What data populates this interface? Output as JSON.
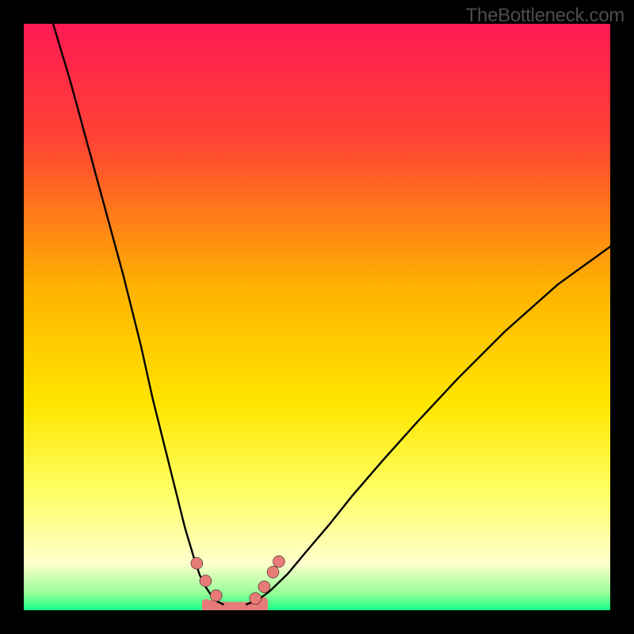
{
  "watermark": "TheBottleneck.com",
  "chart_data": {
    "type": "line",
    "title": "",
    "xlabel": "",
    "ylabel": "",
    "xlim": [
      0,
      100
    ],
    "ylim": [
      0,
      100
    ],
    "gradient_stops": [
      {
        "offset": 0,
        "color": "#ff1a53"
      },
      {
        "offset": 20,
        "color": "#ff4433"
      },
      {
        "offset": 45,
        "color": "#ffb200"
      },
      {
        "offset": 65,
        "color": "#ffe600"
      },
      {
        "offset": 80,
        "color": "#ffff66"
      },
      {
        "offset": 92,
        "color": "#ffffcc"
      },
      {
        "offset": 97,
        "color": "#99ff99"
      },
      {
        "offset": 100,
        "color": "#1aff88"
      }
    ],
    "series": [
      {
        "name": "left-curve",
        "x": [
          5,
          8,
          11,
          14,
          17,
          20,
          22,
          24,
          26,
          27.5,
          29,
          30,
          31,
          32,
          33,
          34
        ],
        "y": [
          100,
          90,
          79,
          68,
          57,
          45,
          36,
          28,
          20,
          14,
          9,
          6,
          4,
          2.5,
          1.5,
          1
        ]
      },
      {
        "name": "right-curve",
        "x": [
          38,
          40,
          42,
          45,
          48,
          52,
          56,
          61,
          67,
          74,
          82,
          91,
          100
        ],
        "y": [
          1,
          1.8,
          3.3,
          6.2,
          9.8,
          14.5,
          19.5,
          25.3,
          32,
          39.5,
          47.5,
          55.5,
          62
        ]
      },
      {
        "name": "valley-floor",
        "x": [
          31,
          33,
          35,
          36.5,
          38,
          39.5,
          41
        ],
        "y": [
          1.3,
          0.9,
          0.8,
          0.8,
          0.8,
          1.1,
          1.6
        ]
      }
    ],
    "markers": [
      {
        "name": "left-dots",
        "x": [
          29.5,
          31,
          32.8
        ],
        "y": [
          8,
          5,
          2.5
        ]
      },
      {
        "name": "right-dots",
        "x": [
          39.5,
          41,
          42.5,
          43.5
        ],
        "y": [
          2,
          4,
          6.5,
          8.3
        ]
      }
    ],
    "valley_fill": {
      "points": [
        [
          31,
          1.3
        ],
        [
          33,
          0.9
        ],
        [
          35,
          0.8
        ],
        [
          36.5,
          0.8
        ],
        [
          38,
          0.8
        ],
        [
          39.5,
          1.1
        ],
        [
          41,
          1.6
        ],
        [
          41,
          0.3
        ],
        [
          31,
          0.3
        ]
      ],
      "color": "#e77b78"
    }
  }
}
